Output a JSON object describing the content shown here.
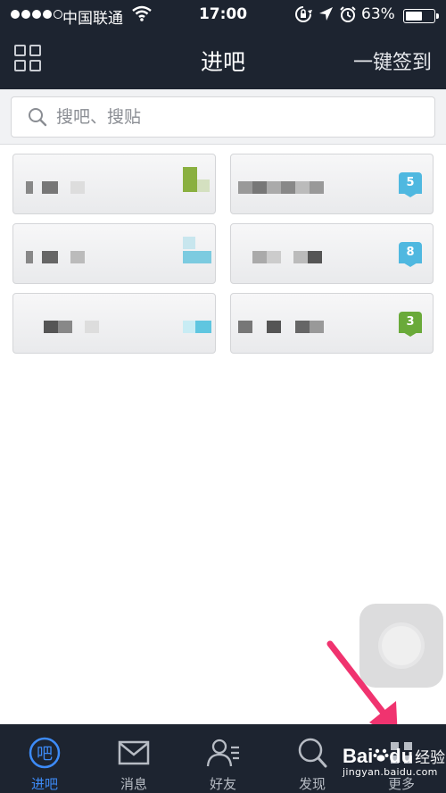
{
  "status": {
    "carrier": "中国联通",
    "time": "17:00",
    "battery_pct": "63%",
    "battery_level": 0.63
  },
  "nav": {
    "title": "进吧",
    "signin_label": "一键签到"
  },
  "search": {
    "placeholder": "搜吧、搜贴"
  },
  "forums": [
    {
      "badge": "5",
      "badge_color": "#4fb8e0"
    },
    {
      "badge": "8",
      "badge_color": "#4fb8e0"
    },
    {
      "badge": "3",
      "badge_color": "#6aaa3a"
    }
  ],
  "tabs": [
    {
      "label": "进吧",
      "icon": "ba-circle-icon",
      "active": true
    },
    {
      "label": "消息",
      "icon": "envelope-icon",
      "active": false
    },
    {
      "label": "好友",
      "icon": "friends-icon",
      "active": false
    },
    {
      "label": "发现",
      "icon": "search-icon",
      "active": false
    },
    {
      "label": "更多",
      "icon": "more-grid-icon",
      "active": false
    }
  ],
  "watermark": {
    "brand": "Bai",
    "brand_suffix": "du",
    "product": "经验",
    "url": "jingyan.baidu.com"
  },
  "colors": {
    "bar_bg": "#1d2430",
    "accent": "#3d8bf7",
    "arrow": "#f0336f"
  }
}
